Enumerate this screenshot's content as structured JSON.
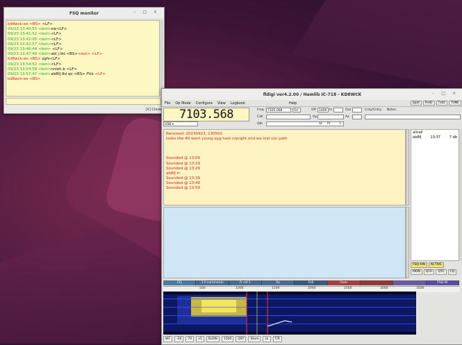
{
  "fsq_window": {
    "title": "FSQ monitor",
    "close_label": "Close",
    "lines": [
      {
        "parts": [
          [
            "red",
            "kd8wck:ee  "
          ],
          [
            "red",
            "<BS> "
          ],
          [
            "blk",
            "<LF>"
          ]
        ]
      },
      {
        "parts": [
          [
            "grn",
            "09/23 13:40:55 <bot>"
          ],
          [
            "blk",
            "xw<LF>"
          ]
        ]
      },
      {
        "parts": [
          [
            "grn",
            "09/23 13:41:52 <bot>"
          ],
          [
            "blk",
            "<LF>"
          ]
        ]
      },
      {
        "parts": [
          [
            "grn",
            "09/23 13:42:05 <bot>"
          ],
          [
            "blk",
            "<LF>"
          ]
        ]
      },
      {
        "parts": [
          [
            "grn",
            "09/23 13:42:57 <bot>"
          ],
          [
            "blk",
            "<LF>"
          ]
        ]
      },
      {
        "parts": [
          [
            "grn",
            "09/23 13:46:44 <bot>"
          ],
          [
            "blk",
            " <LF>"
          ]
        ]
      },
      {
        "parts": [
          [
            "grn",
            "09/23 13:47:48 <bot>"
          ],
          [
            "blk",
            "abl j:9d   <BS>"
          ],
          [
            "red",
            "<eot>"
          ],
          [
            "red",
            " <LF>"
          ]
        ]
      },
      {
        "parts": [
          [
            "red",
            "kd8wck:ee  "
          ],
          [
            "red",
            "<BS> "
          ],
          [
            "blk",
            "zgfs<LF>"
          ]
        ]
      },
      {
        "parts": [
          [
            "grn",
            "09/23 13:54:52 <bot>"
          ],
          [
            "blk",
            "<LF>"
          ]
        ]
      },
      {
        "parts": [
          [
            "grn",
            "09/23 13:54:58 <bot>"
          ],
          [
            "blk",
            "nnleh.b <LF>"
          ]
        ]
      },
      {
        "parts": [
          [
            "grn",
            "09/23 13:57:47 <bot>"
          ],
          [
            "blk",
            "ab8fj:9d qo <BS> f%k  "
          ],
          [
            "red",
            "<LF>"
          ]
        ]
      },
      {
        "parts": [
          [
            "red",
            "kd8wck:ee  "
          ],
          [
            "red",
            "<BS>"
          ]
        ]
      }
    ]
  },
  "fldigi": {
    "title": "fldigi ver4.2.00 / Hamlib IC-718 - KD8WCK",
    "menu": [
      "File",
      "Op Mode",
      "Configure",
      "View",
      "Logbook",
      "Help"
    ],
    "menu_right": [
      "Spot",
      "RxID",
      "TxID",
      "TUNE"
    ],
    "frequency": "7103.568",
    "freq_label": "Freq",
    "freq_value": "7105.068",
    "on_label": "On",
    "off_label": "Off",
    "off_value": "1400",
    "in_label": "In",
    "out_label": "Out",
    "cntry_label": "Cnty/Cntry",
    "notes_label": "Notes",
    "call_label": "Call",
    "op_label": "Op",
    "az_label": "Az",
    "qth_label": "Qth",
    "st_label": "St",
    "pr_label": "Pr",
    "l_label": "L",
    "mode": "USB",
    "rx_lines": [
      {
        "cls": "red",
        "text": "Received: 20230923, 130502"
      },
      {
        "cls": "red",
        "text": "looks like 40 went ysong ayg hast nqnight and we lost our path"
      },
      {
        "cls": "red",
        "text": ""
      },
      {
        "cls": "red",
        "text": ""
      },
      {
        "cls": "red",
        "text": ""
      },
      {
        "cls": "red",
        "text": "Sounded @ 13:09"
      },
      {
        "cls": "red",
        "text": "Sounded @ 13:19"
      },
      {
        "cls": "red",
        "text": "Sounded @ 13:29"
      },
      {
        "cls": "red",
        "text": "ab8fj rr"
      },
      {
        "cls": "red",
        "text": "Sounded @ 13:39"
      },
      {
        "cls": "red",
        "text": "Sounded @ 13:49"
      },
      {
        "cls": "red",
        "text": "Sounded @ 13:59"
      }
    ],
    "heard": {
      "header": "allcall",
      "call": "ab8fj",
      "time": "13:37",
      "db": "7 db"
    },
    "fsq_buttons": {
      "on": "FSQ-ON",
      "active": "ACTIVE",
      "monitor": "MON",
      "qth": "QTH",
      "qtc": "QTC",
      "cq": "CQ"
    },
    "macros": [
      "CQ",
      "3 0 comments",
      "Fr ref 1",
      "Rs",
      "Fell",
      "Over",
      "",
      "",
      "FSQ ID"
    ],
    "scale": [
      "500",
      "1000",
      "1500",
      "2000",
      "2500",
      "3000",
      "3500"
    ],
    "bottom": [
      "WF",
      "-20",
      "70",
      "x1",
      "SLOW",
      "1500",
      "QSY",
      "Store",
      "Lk",
      "T/R"
    ]
  }
}
